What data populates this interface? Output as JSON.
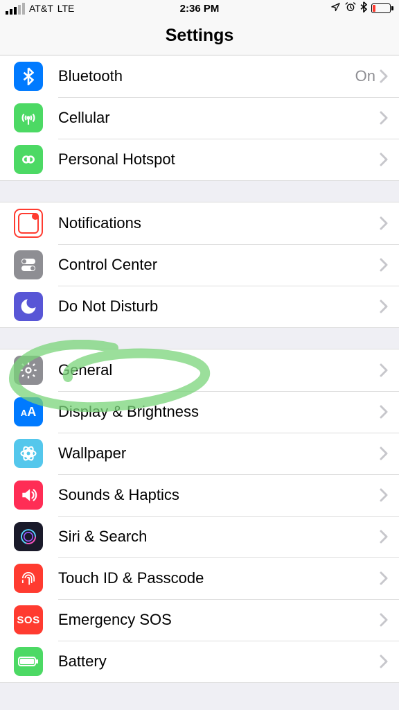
{
  "status": {
    "carrier": "AT&T",
    "network": "LTE",
    "time": "2:36 PM"
  },
  "header": {
    "title": "Settings"
  },
  "sections": [
    {
      "rows": [
        {
          "id": "bluetooth",
          "label": "Bluetooth",
          "value": "On"
        },
        {
          "id": "cellular",
          "label": "Cellular"
        },
        {
          "id": "hotspot",
          "label": "Personal Hotspot"
        }
      ]
    },
    {
      "rows": [
        {
          "id": "notifications",
          "label": "Notifications"
        },
        {
          "id": "controlcenter",
          "label": "Control Center"
        },
        {
          "id": "dnd",
          "label": "Do Not Disturb"
        }
      ]
    },
    {
      "rows": [
        {
          "id": "general",
          "label": "General"
        },
        {
          "id": "display",
          "label": "Display & Brightness"
        },
        {
          "id": "wallpaper",
          "label": "Wallpaper"
        },
        {
          "id": "sounds",
          "label": "Sounds & Haptics"
        },
        {
          "id": "siri",
          "label": "Siri & Search"
        },
        {
          "id": "touchid",
          "label": "Touch ID & Passcode"
        },
        {
          "id": "sos",
          "label": "Emergency SOS",
          "sos_text": "SOS"
        },
        {
          "id": "battery",
          "label": "Battery"
        }
      ]
    }
  ]
}
